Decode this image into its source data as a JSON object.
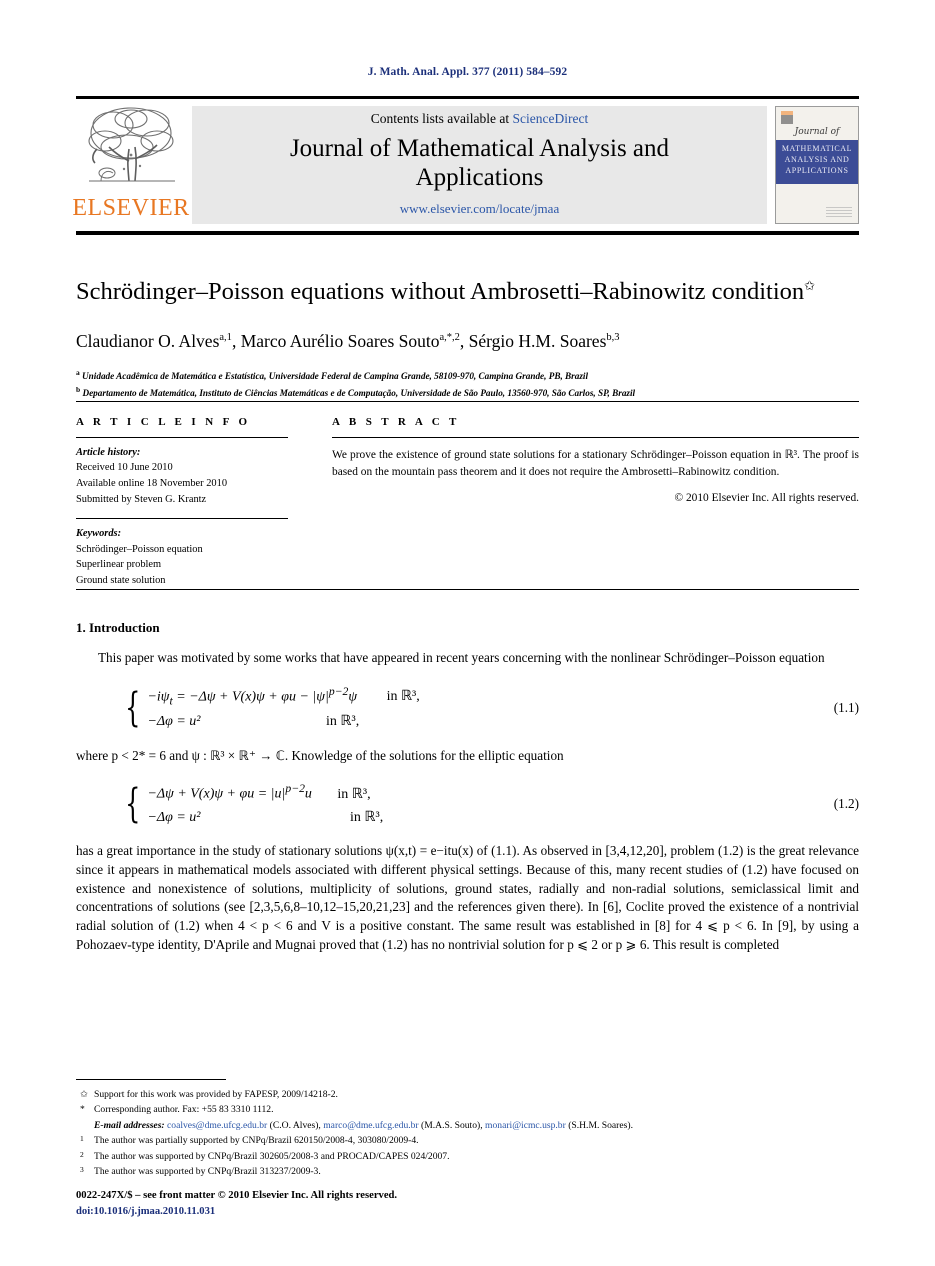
{
  "running_head": "J. Math. Anal. Appl. 377 (2011) 584–592",
  "masthead": {
    "contents_prefix": "Contents lists available at ",
    "sciencedirect": "ScienceDirect",
    "journal_title": "Journal of Mathematical Analysis and Applications",
    "url": "www.elsevier.com/locate/jmaa",
    "publisher": "ELSEVIER",
    "cover": {
      "script": "Journal of",
      "band_line1": "MATHEMATICAL",
      "band_line2": "ANALYSIS AND",
      "band_line3": "APPLICATIONS"
    },
    "link_color": "#2b56a8",
    "logo_color": "#e87722"
  },
  "article": {
    "title": "Schrödinger–Poisson equations without Ambrosetti–Rabinowitz condition",
    "title_footnote_mark": "✩",
    "authors": "Claudianor O. Alves, Marco Aurélio Soares Souto, Sérgio H.M. Soares",
    "author_list": [
      {
        "name": "Claudianor O. Alves",
        "sup": "a,1"
      },
      {
        "name": "Marco Aurélio Soares Souto",
        "sup": "a,*,2"
      },
      {
        "name": "Sérgio H.M. Soares",
        "sup": "b,3"
      }
    ],
    "affiliations": [
      {
        "mark": "a",
        "text": "Unidade Acadêmica de Matemática e Estatística, Universidade Federal de Campina Grande, 58109-970, Campina Grande, PB, Brazil"
      },
      {
        "mark": "b",
        "text": "Departamento de Matemática, Instituto de Ciências Matemáticas e de Computação, Universidade de São Paulo, 13560-970, São Carlos, SP, Brazil"
      }
    ]
  },
  "info": {
    "label": "A R T I C L E    I N F O",
    "history_label": "Article history:",
    "history": [
      "Received 10 June 2010",
      "Available online 18 November 2010",
      "Submitted by Steven G. Krantz"
    ],
    "keywords_label": "Keywords:",
    "keywords": [
      "Schrödinger–Poisson equation",
      "Superlinear problem",
      "Ground state solution"
    ]
  },
  "abstract": {
    "label": "A B S T R A C T",
    "text": "We prove the existence of ground state solutions for a stationary Schrödinger–Poisson equation in ℝ³. The proof is based on the mountain pass theorem and it does not require the Ambrosetti–Rabinowitz condition.",
    "copyright": "© 2010 Elsevier Inc. All rights reserved."
  },
  "body": {
    "section_heading": "1. Introduction",
    "para1": "This paper was motivated by some works that have appeared in recent years concerning with the nonlinear Schrödinger–Poisson equation",
    "eq1": {
      "row1_lhs": "−iψ",
      "row1_sub": "t",
      "row1_rest": " = −Δψ + V(x)ψ + φu − |ψ|",
      "row1_exp": "p−2",
      "row1_tail": "ψ",
      "row1_cond": "in ℝ³,",
      "row2": "−Δφ = u²",
      "row2_cond": "in ℝ³,",
      "number": "(1.1)"
    },
    "para2": "where p < 2* = 6 and ψ : ℝ³ × ℝ⁺ → ℂ. Knowledge of the solutions for the elliptic equation",
    "eq2": {
      "row1": "−Δψ + V(x)ψ + φu = |u|",
      "row1_exp": "p−2",
      "row1_tail": "u",
      "row1_cond": "in ℝ³,",
      "row2": "−Δφ = u²",
      "row2_cond": "in ℝ³,",
      "number": "(1.2)"
    },
    "para3": "has a great importance in the study of stationary solutions ψ(x,t) = e−itu(x) of (1.1). As observed in [3,4,12,20], problem (1.2) is the great relevance since it appears in mathematical models associated with different physical settings. Because of this, many recent studies of (1.2) have focused on existence and nonexistence of solutions, multiplicity of solutions, ground states, radially and non-radial solutions, semiclassical limit and concentrations of solutions (see [2,3,5,6,8–10,12–15,20,21,23] and the references given there). In [6], Coclite proved the existence of a nontrivial radial solution of (1.2) when 4 < p < 6 and V is a positive constant. The same result was established in [8] for 4 ⩽ p < 6. In [9], by using a Pohozaev-type identity, D'Aprile and Mugnai proved that (1.2) has no nontrivial solution for p ⩽ 2 or p ⩾ 6. This result is completed"
  },
  "footnotes": [
    {
      "mark": "✩",
      "text": "Support for this work was provided by FAPESP, 2009/14218-2."
    },
    {
      "mark": "*",
      "text": "Corresponding author. Fax: +55 83 3310 1112."
    },
    {
      "mark": "",
      "label": "E-mail addresses:",
      "emails": [
        {
          "address": "coalves@dme.ufcg.edu.br",
          "owner": "(C.O. Alves)"
        },
        {
          "address": "marco@dme.ufcg.edu.br",
          "owner": "(M.A.S. Souto)"
        },
        {
          "address": "monari@icmc.usp.br",
          "owner": "(S.H.M. Soares)"
        }
      ]
    },
    {
      "mark": "1",
      "text": "The author was partially supported by CNPq/Brazil 620150/2008-4, 303080/2009-4."
    },
    {
      "mark": "2",
      "text": "The author was supported by CNPq/Brazil 302605/2008-3 and PROCAD/CAPES 024/2007."
    },
    {
      "mark": "3",
      "text": "The author was supported by CNPq/Brazil 313237/2009-3."
    }
  ],
  "imprint": {
    "line1": "0022-247X/$ – see front matter © 2010 Elsevier Inc. All rights reserved.",
    "doi": "doi:10.1016/j.jmaa.2010.11.031"
  }
}
